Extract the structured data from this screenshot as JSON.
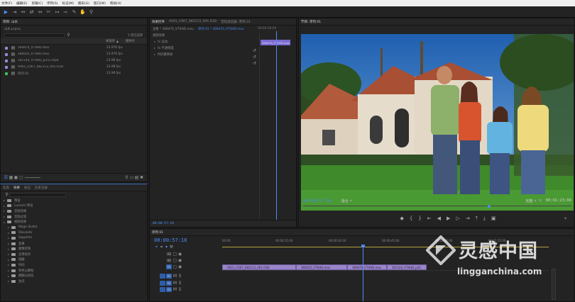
{
  "menu": [
    "文件(F)",
    "编辑(E)",
    "剪辑(C)",
    "序列(S)",
    "标记(M)",
    "图形(G)",
    "窗口(W)",
    "帮助(H)"
  ],
  "tools": [
    "selection-tool",
    "track-select-tool",
    "ripple-edit-tool",
    "rolling-edit-tool",
    "rate-stretch-tool",
    "razor-tool",
    "slip-tool",
    "slide-tool",
    "pen-tool",
    "hand-tool",
    "zoom-tool"
  ],
  "project": {
    "tab": "项目: 山水",
    "file": "山水.prproj",
    "count": "1 项已选择",
    "col_framerate": "帧速率",
    "col_media": "媒体开",
    "items": [
      {
        "name": "369470_VTXHD.mov",
        "fps": "23.976 fps",
        "color": "#9a8ad8"
      },
      {
        "name": "368505_VTXHD.mov",
        "fps": "23.976 fps",
        "color": "#9a8ad8"
      },
      {
        "name": "301144_VTXHD_p255.mp4",
        "fps": "23.98 fps",
        "color": "#9a8ad8"
      },
      {
        "name": "A001_C067_0821C2_001.R3D",
        "fps": "23.98 fps",
        "color": "#9a8ad8"
      },
      {
        "name": "序列 01",
        "fps": "23.98 fps",
        "color": "#3fbf5a"
      }
    ]
  },
  "effects_panel": {
    "tabs": [
      "信息",
      "效果",
      "标记",
      "历史记录"
    ],
    "active": "效果",
    "folders": [
      "预设",
      "Lumetri 预设",
      "音频效果",
      "音频过渡",
      "视频效果",
      "Magic Bullet",
      "Obsolete",
      "Sapphire",
      "变换",
      "图像控制",
      "实用程序",
      "扭曲",
      "时间",
      "杂色与颗粒",
      "模糊与锐化",
      "生成"
    ]
  },
  "effect_controls": {
    "tabs": [
      "效果控件",
      "A001_C067_0821C2_001.R3D",
      "音轨混合器: 序列 01"
    ],
    "source": "主要 * 369470_VTXHD.mov",
    "target": "序列 01 * 369470_VTXHD.mov",
    "video_effects": "视频效果",
    "rows": [
      "fx 运动",
      "fx 不透明度",
      "时间重映射"
    ],
    "clip_label": "369470_VTXHD.mov",
    "timecode": "00:00:57:18",
    "ruler": "00:00:50:00"
  },
  "program": {
    "tab": "节目: 序列 01",
    "timecode": "00:00:57:18",
    "fit": "适合",
    "quality": "完整",
    "duration": "00:01:23:04"
  },
  "timeline": {
    "tab": "序列 01",
    "timecode": "00:00:57:18",
    "ruler": [
      "00:00",
      "00:00:15:00",
      "00:00:30:00",
      "00:00:45:00",
      "00:01:00:00",
      "00:01:15:00"
    ],
    "video_tracks": [
      "V3",
      "V2",
      "V1"
    ],
    "audio_tracks": [
      "A1",
      "A2",
      "A3"
    ],
    "clips": [
      {
        "name": "A001_C067_0821C2_001.R3D"
      },
      {
        "name": "368505_VTXHD.mov"
      },
      {
        "name": "369470_VTXHD.mov"
      },
      {
        "name": "301144_VTXHD_p25"
      }
    ]
  },
  "watermark": {
    "brand": "灵感中国",
    "url": "lingganchina.com"
  }
}
